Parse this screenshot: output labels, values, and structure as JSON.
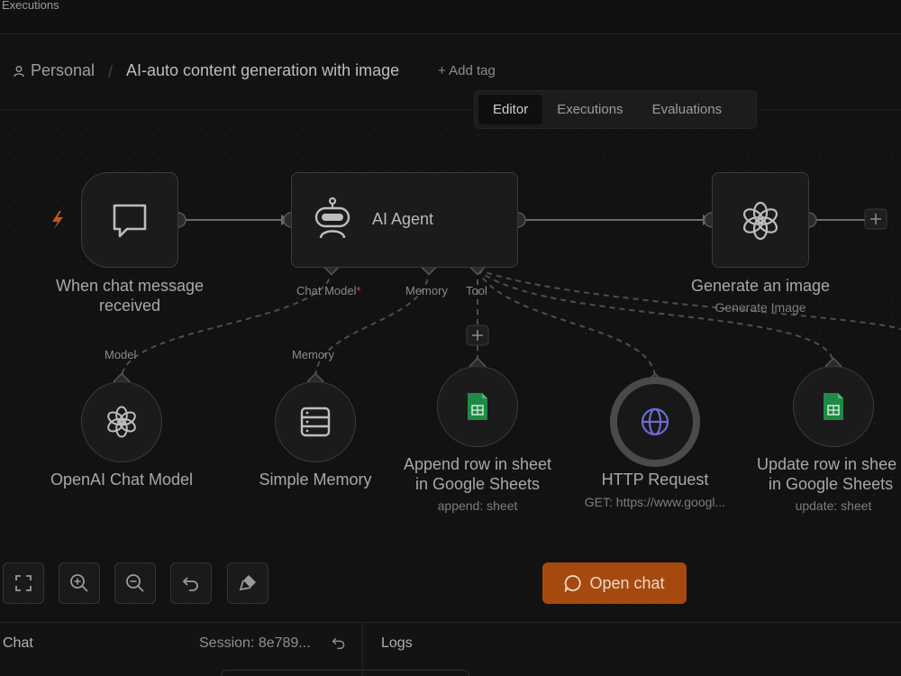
{
  "window": {
    "title": "Executions"
  },
  "breadcrumb": {
    "project": "Personal",
    "workflow_name": "AI-auto content generation with image",
    "add_tag": "+ Add tag"
  },
  "tabs": [
    {
      "label": "Editor",
      "active": true
    },
    {
      "label": "Executions",
      "active": false
    },
    {
      "label": "Evaluations",
      "active": false
    }
  ],
  "nodes": {
    "trigger": {
      "label_line1": "When chat message",
      "label_line2": "received",
      "icon": "chat-bubble-icon"
    },
    "agent": {
      "label": "AI Agent",
      "icon": "robot-icon",
      "ports": {
        "chat_model": "Chat Model",
        "chat_model_required": "*",
        "memory": "Memory",
        "tool": "Tool"
      }
    },
    "generate_image": {
      "label": "Generate an image",
      "subtitle": "Generate Image",
      "icon": "openai-icon"
    },
    "openai_chat": {
      "port_label": "Model",
      "label": "OpenAI Chat Model",
      "icon": "openai-icon"
    },
    "simple_memory": {
      "port_label": "Memory",
      "label": "Simple Memory",
      "icon": "database-icon"
    },
    "append_row": {
      "label_line1": "Append row in sheet",
      "label_line2": "in Google Sheets",
      "subtitle": "append: sheet",
      "icon": "google-sheets-icon"
    },
    "http_request": {
      "label": "HTTP Request",
      "subtitle": "GET: https://www.googl...",
      "icon": "globe-icon"
    },
    "update_row": {
      "label_line1": "Update row in shee",
      "label_line2": "in Google Sheets",
      "subtitle": "update: sheet",
      "icon": "google-sheets-icon"
    }
  },
  "controls": {
    "open_chat": "Open chat",
    "icons": [
      "fit-view-icon",
      "zoom-in-icon",
      "zoom-out-icon",
      "undo-icon",
      "clear-icon"
    ]
  },
  "bottom_panel": {
    "chat": "Chat",
    "session": "Session: 8e789...",
    "logs": "Logs"
  },
  "colors": {
    "accent": "#a5490f",
    "trigger_bolt": "#c0561e",
    "sheets_green": "#1f8a45",
    "globe_blue": "#6b6ed0"
  }
}
